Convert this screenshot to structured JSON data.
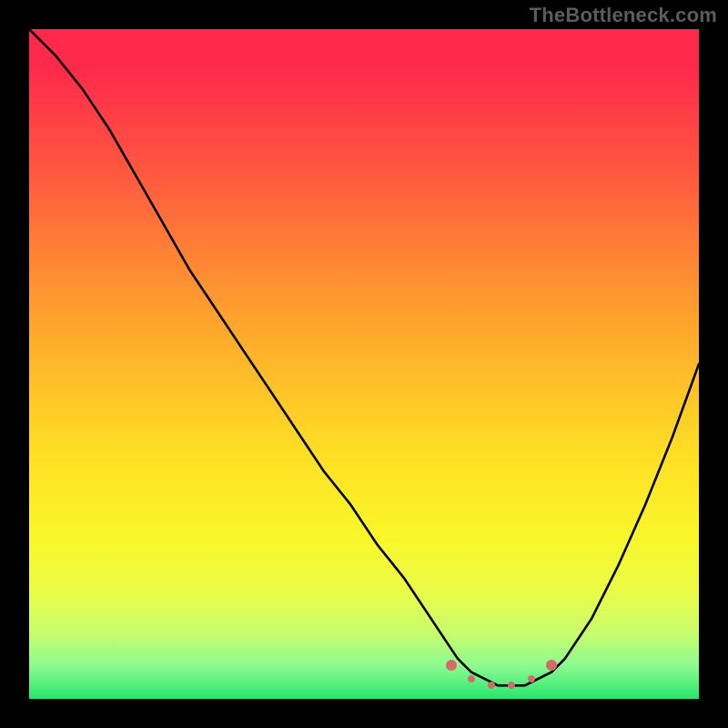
{
  "watermark": "TheBottleneck.com",
  "colors": {
    "background": "#000000",
    "gradient_top": "#ff2a4b",
    "gradient_bottom": "#28e56f",
    "curve": "#000000",
    "marker": "#d46a6a"
  },
  "chart_data": {
    "type": "line",
    "title": "",
    "xlabel": "",
    "ylabel": "",
    "xlim": [
      0,
      100
    ],
    "ylim": [
      0,
      100
    ],
    "grid": false,
    "legend": false,
    "annotations": [],
    "series": [
      {
        "name": "curve",
        "x": [
          0,
          4,
          8,
          12,
          16,
          20,
          24,
          28,
          32,
          36,
          40,
          44,
          48,
          52,
          56,
          60,
          62,
          64,
          66,
          68,
          70,
          72,
          74,
          76,
          78,
          80,
          84,
          88,
          92,
          96,
          100
        ],
        "values": [
          100,
          96,
          91,
          85,
          78,
          71,
          64,
          58,
          52,
          46,
          40,
          34,
          29,
          23,
          18,
          12,
          9,
          6,
          4,
          3,
          2,
          2,
          2,
          3,
          4,
          6,
          12,
          20,
          29,
          39,
          50
        ]
      }
    ],
    "markers": [
      {
        "x": 63,
        "y": 5,
        "size": "large"
      },
      {
        "x": 66,
        "y": 3,
        "size": "small"
      },
      {
        "x": 69,
        "y": 2,
        "size": "small"
      },
      {
        "x": 72,
        "y": 2,
        "size": "small"
      },
      {
        "x": 75,
        "y": 3,
        "size": "small"
      },
      {
        "x": 78,
        "y": 5,
        "size": "large"
      }
    ]
  }
}
